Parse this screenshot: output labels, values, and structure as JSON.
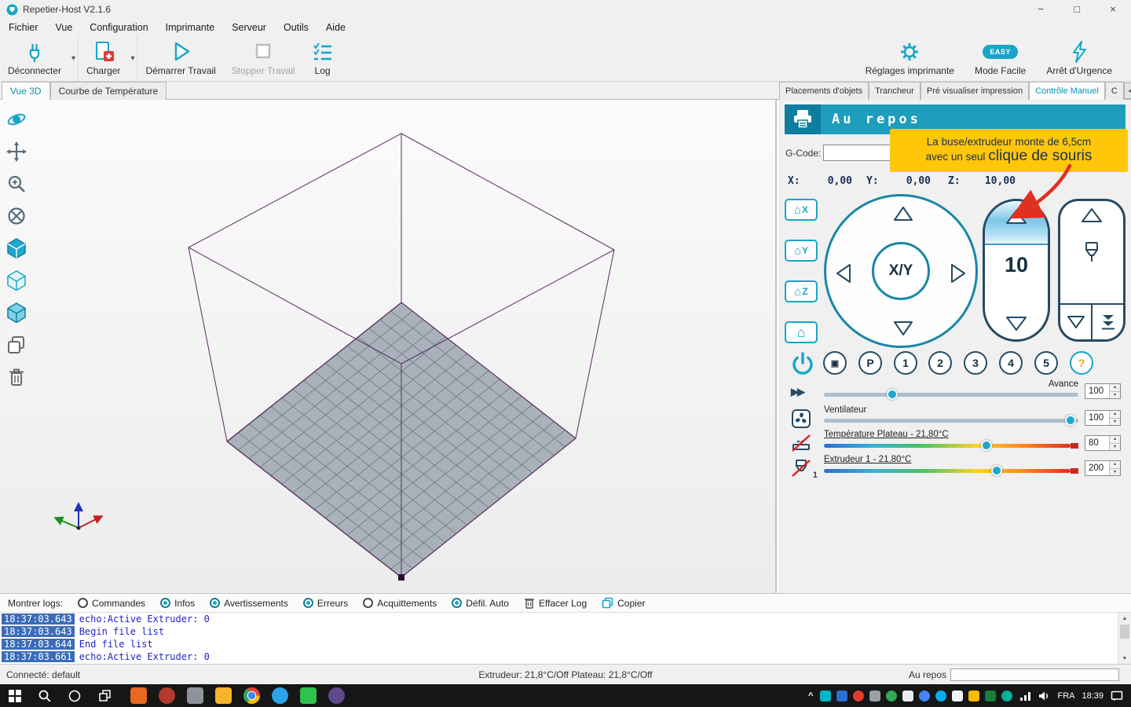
{
  "colors": {
    "accent": "#16a6c8",
    "accent_dark": "#0d7da0",
    "status_header_bg": "#1e9dbd",
    "tooltip_bg": "#ffc60a",
    "tooltip_text": "#17305a",
    "log_time_bg": "#3b6cb8",
    "log_text": "#2323c8",
    "annotation_red": "#e03020",
    "bed_fill": "#a9b2ba",
    "wireframe_purple": "#5c2a64",
    "taskbar_bg": "#161616"
  },
  "window": {
    "title": "Repetier-Host V2.1.6"
  },
  "menu": {
    "items": [
      "Fichier",
      "Vue",
      "Configuration",
      "Imprimante",
      "Serveur",
      "Outils",
      "Aide"
    ]
  },
  "toolbar": {
    "disconnect": "Déconnecter",
    "load": "Charger",
    "start_job": "Démarrer Travail",
    "stop_job": "Stopper Travail",
    "log": "Log",
    "printer_settings": "Réglages imprimante",
    "easy_badge": "EASY",
    "easy_mode": "Mode Facile",
    "emergency": "Arrêt d'Urgence"
  },
  "view_tabs": {
    "view3d": "Vue 3D",
    "temp_curve": "Courbe de Température"
  },
  "right_tabs": {
    "items": [
      "Placements d'objets",
      "Trancheur",
      "Pré visualiser impression",
      "Contrôle Manuel",
      "C"
    ]
  },
  "manual_control": {
    "status": "Au repos",
    "gcode_label": "G-Code:",
    "gcode_value": "",
    "x_label": "X:",
    "x_value": "0,00",
    "y_label": "Y:",
    "y_value": "0,00",
    "z_label": "Z:",
    "z_value": "10,00",
    "home_x": "X",
    "home_y": "Y",
    "home_z": "Z",
    "dpad_center": "X/Y",
    "z_step": "10",
    "buttons": [
      "P",
      "1",
      "2",
      "3",
      "4",
      "5"
    ],
    "help_button": "?",
    "extruder_icon_label": "1",
    "sliders": [
      {
        "label": "Avance",
        "value": "100",
        "pos": 27
      },
      {
        "label": "Ventilateur",
        "value": "100",
        "pos": 97
      },
      {
        "label": "Température Plateau - 21,80°C",
        "value": "80",
        "pos": 66
      },
      {
        "label": "Extrudeur 1 - 21,80°C",
        "value": "200",
        "pos": 70
      }
    ]
  },
  "tooltip": {
    "line1": "La buse/extrudeur monte de 6,5cm",
    "line2_start": "avec un seul",
    "line2_emph": "clique de souris"
  },
  "log_controls": {
    "label": "Montrer logs:",
    "filters": [
      {
        "label": "Commandes",
        "checked": false
      },
      {
        "label": "Infos",
        "checked": true
      },
      {
        "label": "Avertissements",
        "checked": true
      },
      {
        "label": "Erreurs",
        "checked": true
      },
      {
        "label": "Acquittements",
        "checked": false
      },
      {
        "label": "Défil. Auto",
        "checked": true
      }
    ],
    "clear_log": "Effacer Log",
    "copy": "Copier"
  },
  "log": {
    "lines": [
      {
        "time": "18:37:03.643",
        "text": "echo:Active Extruder: 0"
      },
      {
        "time": "18:37:03.643",
        "text": "Begin file list"
      },
      {
        "time": "18:37:03.644",
        "text": "End file list"
      },
      {
        "time": "18:37:03.661",
        "text": "echo:Active Extruder: 0"
      }
    ]
  },
  "status_bar": {
    "left": "Connecté: default",
    "center": "Extrudeur: 21,8°C/Off Plateau: 21,8°C/Off",
    "right": "Au repos"
  },
  "taskbar": {
    "language": "FRA",
    "time": "18:39",
    "apps": [
      {
        "color": "#e8681f"
      },
      {
        "color": "#b33a2a",
        "round": true
      },
      {
        "color": "#8d939b"
      },
      {
        "color": "#f7b32a"
      },
      {
        "color": "radial-gradient(circle, #4285f4 0 31%, #fff 32% 38%, transparent 39%), conic-gradient(from -30deg, #ea4335 0 120deg, #fbbc04 0 240deg, #34a853 0 360deg)",
        "round": true
      },
      {
        "color": "#2aa3e8",
        "round": true
      },
      {
        "color": "#2ec24f"
      },
      {
        "color": "#5c4a8c",
        "round": true
      }
    ],
    "tray": [
      {
        "color": "#00b7c3"
      },
      {
        "color": "#2b6fd4"
      },
      {
        "color": "#e03c31",
        "round": true
      },
      {
        "color": "#9aa0a6"
      },
      {
        "color": "#34a853",
        "round": true
      },
      {
        "color": "#e8eaed"
      },
      {
        "color": "#4285f4",
        "round": true
      },
      {
        "color": "#00aff0",
        "round": true
      },
      {
        "color": "#f1f3f4"
      },
      {
        "color": "#fbbc04"
      },
      {
        "color": "#188038"
      },
      {
        "color": "#00b294",
        "round": true
      }
    ]
  },
  "icons": {
    "dropdown": "▾",
    "minimize": "−",
    "maximize": "□",
    "close": "×",
    "scroll_left": "◀",
    "scroll_right": "▶",
    "scroll_up": "▲",
    "scroll_down": "▼",
    "home": "⌂",
    "fast_forward": "▶▶",
    "motor": "▣",
    "spin_up": "▲",
    "spin_down": "▼",
    "tray_expand": "^"
  }
}
